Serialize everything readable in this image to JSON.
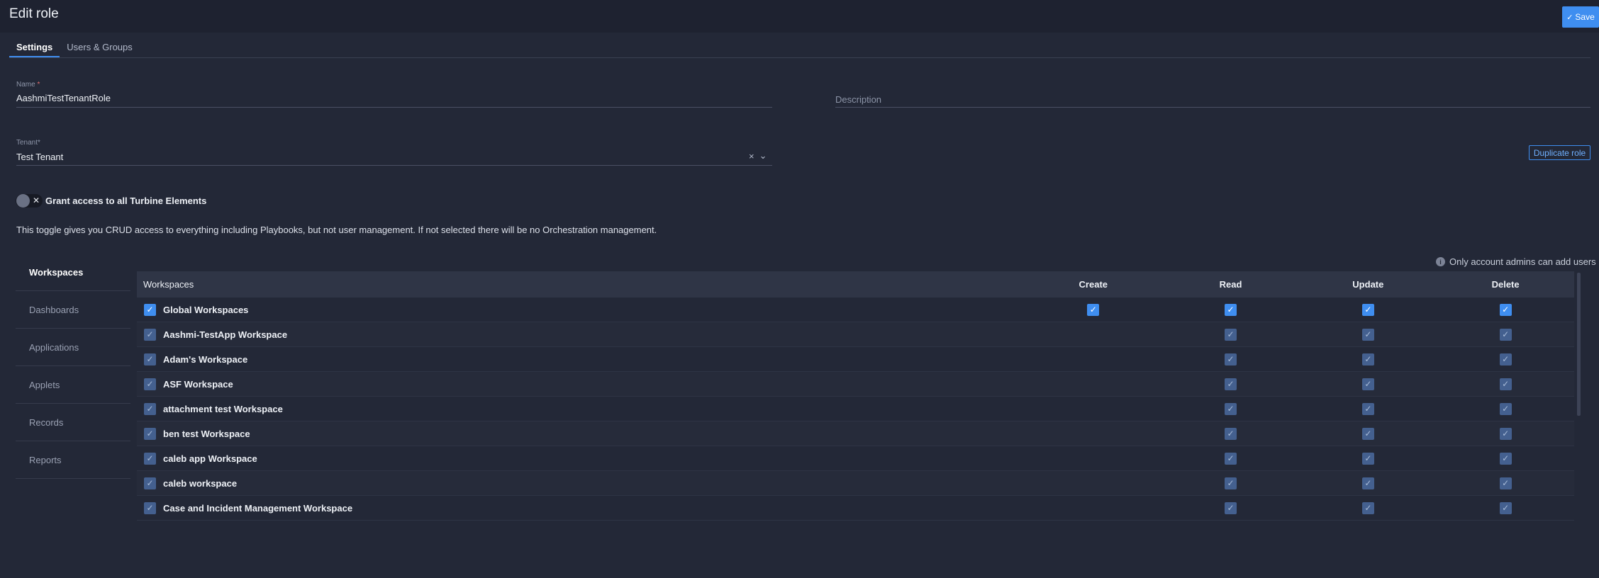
{
  "header": {
    "title": "Edit role",
    "save_label": "Save"
  },
  "tabs": [
    {
      "label": "Settings",
      "active": true
    },
    {
      "label": "Users & Groups",
      "active": false
    }
  ],
  "form": {
    "name_label": "Name",
    "required_marker": "*",
    "name_value": "AashmiTestTenantRole",
    "description_placeholder": "Description",
    "tenant_label": "Tenant*",
    "tenant_value": "Test Tenant",
    "tenant_clear_icon": "×",
    "tenant_dropdown_icon": "⌄",
    "duplicate_label": "Duplicate role"
  },
  "toggle": {
    "label": "Grant access to all Turbine Elements",
    "state": "off",
    "help": "This toggle gives you CRUD access to everything including Playbooks, but not user management. If not selected there will be no Orchestration management."
  },
  "side_nav": [
    {
      "label": "Workspaces",
      "active": true
    },
    {
      "label": "Dashboards",
      "active": false
    },
    {
      "label": "Applications",
      "active": false
    },
    {
      "label": "Applets",
      "active": false
    },
    {
      "label": "Records",
      "active": false
    },
    {
      "label": "Reports",
      "active": false
    }
  ],
  "info_note": "Only account admins can add users",
  "table": {
    "headers": [
      "Workspaces",
      "Create",
      "Read",
      "Update",
      "Delete"
    ],
    "rows": [
      {
        "name": "Global Workspaces",
        "create": true,
        "read": true,
        "update": true,
        "delete": true,
        "style": "bright"
      },
      {
        "name": "Aashmi-TestApp Workspace",
        "create": false,
        "read": true,
        "update": true,
        "delete": true,
        "style": "dim"
      },
      {
        "name": "Adam's Workspace",
        "create": false,
        "read": true,
        "update": true,
        "delete": true,
        "style": "dim"
      },
      {
        "name": "ASF Workspace",
        "create": false,
        "read": true,
        "update": true,
        "delete": true,
        "style": "dim"
      },
      {
        "name": "attachment test Workspace",
        "create": false,
        "read": true,
        "update": true,
        "delete": true,
        "style": "dim"
      },
      {
        "name": "ben test Workspace",
        "create": false,
        "read": true,
        "update": true,
        "delete": true,
        "style": "dim"
      },
      {
        "name": "caleb app Workspace",
        "create": false,
        "read": true,
        "update": true,
        "delete": true,
        "style": "dim"
      },
      {
        "name": "caleb workspace",
        "create": false,
        "read": true,
        "update": true,
        "delete": true,
        "style": "dim"
      },
      {
        "name": "Case and Incident Management Workspace",
        "create": false,
        "read": true,
        "update": true,
        "delete": true,
        "style": "dim"
      }
    ]
  },
  "colors": {
    "accent": "#3f8ef0",
    "background": "#232837",
    "header_bg": "#1e2230"
  }
}
